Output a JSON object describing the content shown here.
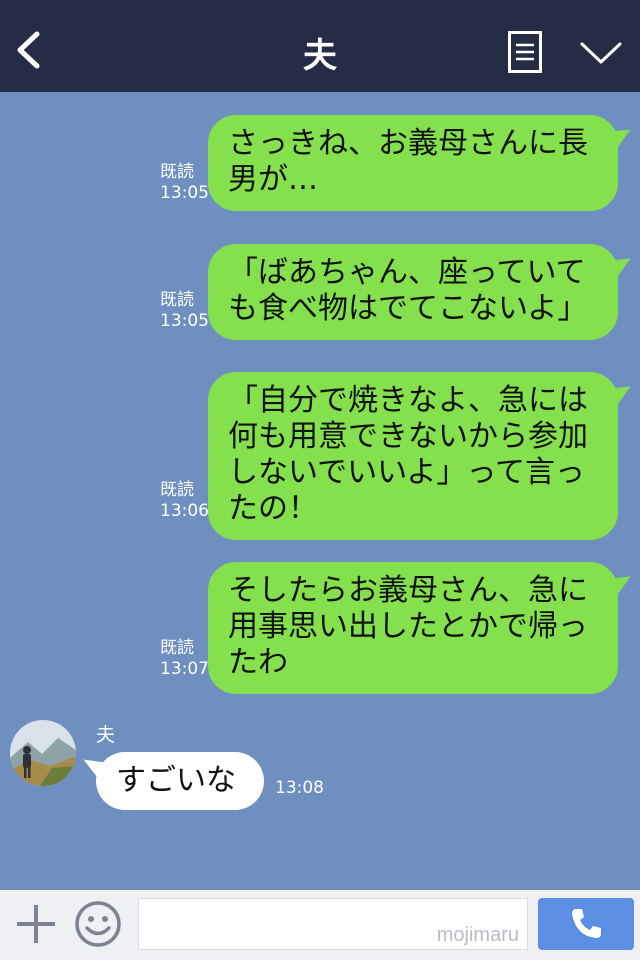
{
  "header": {
    "title": "夫"
  },
  "messages_out": [
    {
      "lines": [
        "さっきね、お義母さんに長",
        "男が…"
      ],
      "read": "既読",
      "time": "13:05"
    },
    {
      "lines": [
        "「ばあちゃん、座っていて",
        "も食べ物はでてこないよ」"
      ],
      "read": "既読",
      "time": "13:05"
    },
    {
      "lines": [
        "「自分で焼きなよ、急には",
        "何も用意できないから参加",
        "しないでいいよ」って言っ",
        "たの！"
      ],
      "read": "既読",
      "time": "13:06"
    },
    {
      "lines": [
        "そしたらお義母さん、急に",
        "用事思い出したとかで帰っ",
        "たわ"
      ],
      "read": "既読",
      "time": "13:07"
    }
  ],
  "message_in": {
    "sender": "夫",
    "text": "すごいな",
    "time": "13:08"
  },
  "footer": {
    "input_value": "",
    "watermark": "mojimaru"
  },
  "icons": [
    "back-icon",
    "menu-icon",
    "chevron-down-icon",
    "plus-icon",
    "smile-icon",
    "phone-icon"
  ]
}
